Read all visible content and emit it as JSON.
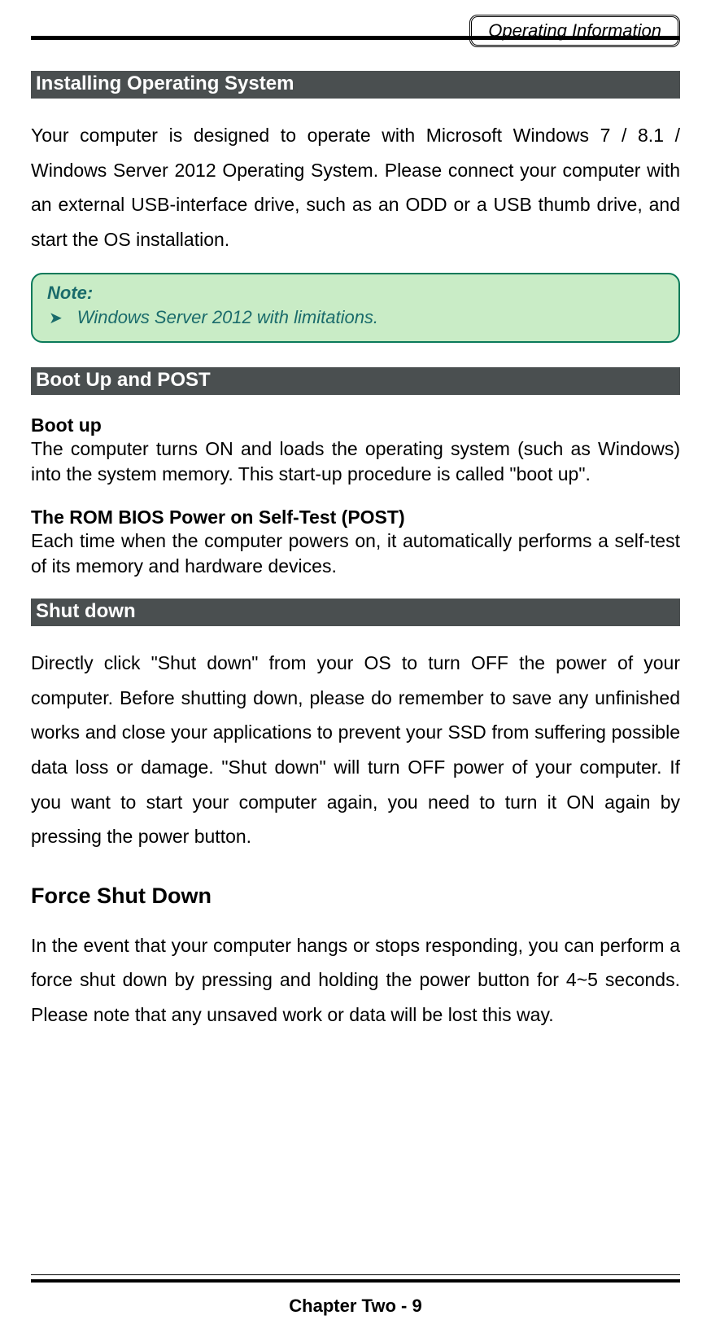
{
  "header": {
    "label": "Operating Information"
  },
  "sections": {
    "installing": {
      "title": " Installing Operating System",
      "body": "Your computer is designed to operate with Microsoft Windows 7 / 8.1 / Windows Server 2012 Operating System. Please connect your computer with an external USB-interface drive, such as an ODD or a USB thumb drive, and start the OS installation."
    },
    "note": {
      "title": "Note:",
      "arrow": "➤",
      "text": "Windows Server 2012 with limitations."
    },
    "boot": {
      "title": " Boot Up and POST",
      "sub1_title": "Boot up",
      "sub1_body": "The computer turns ON and loads the operating system (such as Windows) into the system memory. This start-up procedure is called \"boot up\".",
      "sub2_title": "The ROM BIOS Power on Self-Test (POST)",
      "sub2_body": "Each time when the computer powers on, it automatically performs a self-test of its memory and hardware devices."
    },
    "shutdown": {
      "title": " Shut down",
      "body": "Directly click \"Shut down\" from your OS to turn OFF the power of your computer. Before shutting down, please do remember to save any unfinished works and close your applications to prevent your SSD from suffering possible data loss or damage. \"Shut down\" will turn OFF power of your computer. If you want to start your computer again, you need to turn it ON again by pressing the power button.",
      "force_title": "Force Shut Down",
      "force_body": "In the event that your computer hangs or stops responding, you can perform a force shut down by pressing and holding the power button for 4~5 seconds. Please note that any unsaved work or data will be lost this way."
    }
  },
  "footer": {
    "text": "Chapter Two - 9"
  }
}
